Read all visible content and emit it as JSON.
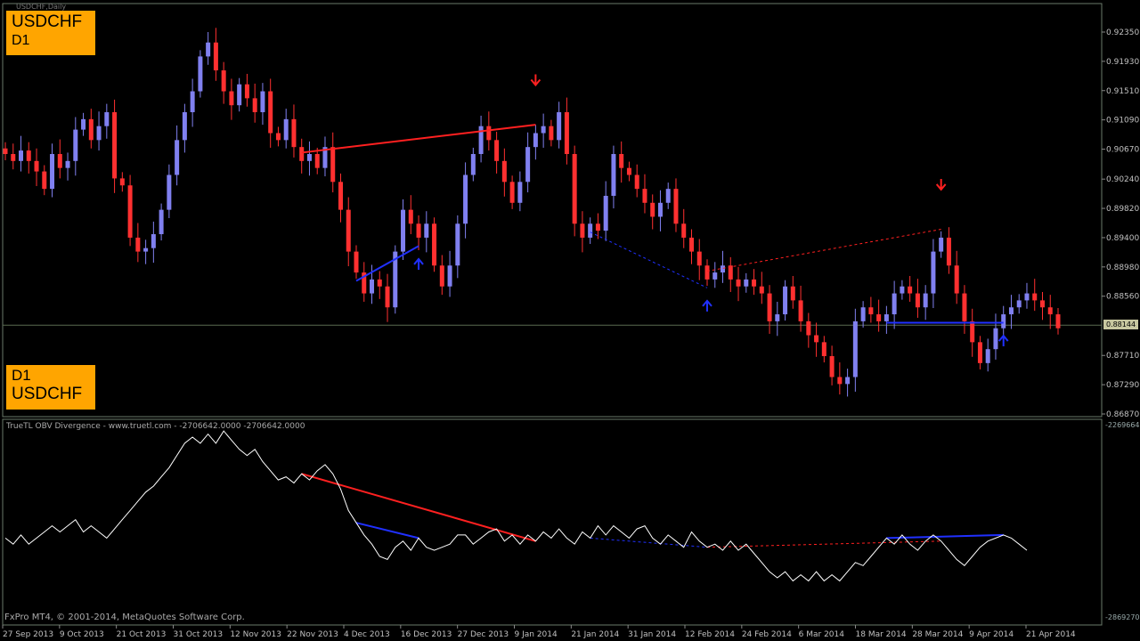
{
  "window": {
    "chart_title": "USDCHF,Daily",
    "badge_top": {
      "symbol": "USDCHF",
      "timeframe": "D1"
    },
    "badge_bottom": {
      "timeframe": "D1",
      "symbol": "USDCHF"
    },
    "indicator_title": "TrueTL OBV Divergence - www.truetl.com -  -2706642.0000 -2706642.0000",
    "copyright": "FxPro MT4, © 2001-2014, MetaQuotes Software Corp.",
    "current_price": "0.88144",
    "indicator_top_value": "-2269664",
    "indicator_bottom_value": "-2869270"
  },
  "colors": {
    "background": "#000000",
    "bull_candle": "#8080f0",
    "bear_candle": "#ff3030",
    "obv_line": "#ffffff",
    "bearish_divergence": "#ff2020",
    "bullish_divergence": "#2030ff",
    "badge": "#ffa500",
    "axis_text": "#c0c0c0"
  },
  "chart_data": [
    {
      "type": "candlestick",
      "title": "",
      "ylim": [
        0.8675,
        0.9255
      ],
      "y_ticks": [
        "0.92350",
        "0.91930",
        "0.91510",
        "0.91090",
        "0.90670",
        "0.90240",
        "0.89820",
        "0.89400",
        "0.88980",
        "0.88560",
        "0.87710",
        "0.87290",
        "0.86870"
      ],
      "x_ticks": [
        "27 Sep 2013",
        "9 Oct 2013",
        "21 Oct 2013",
        "31 Oct 2013",
        "12 Nov 2013",
        "22 Nov 2013",
        "4 Dec 2013",
        "16 Dec 2013",
        "27 Dec 2013",
        "9 Jan 2014",
        "21 Jan 2014",
        "31 Jan 2014",
        "12 Feb 2014",
        "24 Feb 2014",
        "6 Mar 2014",
        "18 Mar 2014",
        "28 Mar 2014",
        "9 Apr 2014",
        "21 Apr 2014"
      ],
      "close_series": [
        0.906,
        0.905,
        0.9065,
        0.905,
        0.9035,
        0.901,
        0.906,
        0.904,
        0.905,
        0.9095,
        0.911,
        0.908,
        0.91,
        0.912,
        0.9025,
        0.9015,
        0.894,
        0.892,
        0.8925,
        0.8945,
        0.898,
        0.903,
        0.908,
        0.912,
        0.915,
        0.92,
        0.922,
        0.918,
        0.915,
        0.913,
        0.916,
        0.914,
        0.912,
        0.915,
        0.909,
        0.908,
        0.911,
        0.907,
        0.905,
        0.906,
        0.904,
        0.907,
        0.902,
        0.898,
        0.892,
        0.889,
        0.886,
        0.888,
        0.887,
        0.884,
        0.892,
        0.898,
        0.896,
        0.894,
        0.896,
        0.89,
        0.887,
        0.89,
        0.896,
        0.903,
        0.906,
        0.91,
        0.908,
        0.905,
        0.902,
        0.899,
        0.902,
        0.907,
        0.909,
        0.91,
        0.908,
        0.912,
        0.906,
        0.896,
        0.894,
        0.896,
        0.895,
        0.9,
        0.906,
        0.904,
        0.903,
        0.901,
        0.899,
        0.897,
        0.899,
        0.901,
        0.896,
        0.894,
        0.892,
        0.89,
        0.888,
        0.889,
        0.89,
        0.888,
        0.887,
        0.888,
        0.887,
        0.886,
        0.882,
        0.883,
        0.887,
        0.885,
        0.882,
        0.88,
        0.879,
        0.877,
        0.874,
        0.873,
        0.874,
        0.882,
        0.884,
        0.883,
        0.882,
        0.883,
        0.886,
        0.887,
        0.886,
        0.884,
        0.886,
        0.892,
        0.894,
        0.89,
        0.886,
        0.882,
        0.879,
        0.876,
        0.878,
        0.881,
        0.883,
        0.884,
        0.885,
        0.886,
        0.885,
        0.884,
        0.883,
        0.881
      ],
      "divergences": [
        {
          "kind": "bearish",
          "from_date": "22 Nov 2013",
          "to_date": "9 Jan 2014"
        },
        {
          "kind": "bullish",
          "from_date": "4 Dec 2013",
          "to_date": "16 Dec 2013"
        },
        {
          "kind": "bullish-hidden",
          "from_date": "21 Jan 2014",
          "to_date": "12 Feb 2014"
        },
        {
          "kind": "bearish-hidden",
          "from_date": "12 Feb 2014",
          "to_date": "28 Mar 2014"
        },
        {
          "kind": "bullish",
          "from_date": "18 Mar 2014",
          "to_date": "9 Apr 2014"
        }
      ]
    },
    {
      "type": "line",
      "title": "TrueTL OBV Divergence",
      "ylim": [
        -2869270,
        -2269664
      ],
      "series": [
        {
          "values": [
            -2620000,
            -2640000,
            -2610000,
            -2640000,
            -2620000,
            -2600000,
            -2580000,
            -2600000,
            -2580000,
            -2560000,
            -2600000,
            -2580000,
            -2600000,
            -2620000,
            -2590000,
            -2560000,
            -2530000,
            -2500000,
            -2470000,
            -2450000,
            -2420000,
            -2390000,
            -2350000,
            -2310000,
            -2290000,
            -2310000,
            -2280000,
            -2310000,
            -2270000,
            -2300000,
            -2330000,
            -2350000,
            -2330000,
            -2370000,
            -2400000,
            -2430000,
            -2420000,
            -2440000,
            -2410000,
            -2430000,
            -2400000,
            -2380000,
            -2410000,
            -2460000,
            -2530000,
            -2570000,
            -2610000,
            -2640000,
            -2680000,
            -2690000,
            -2650000,
            -2630000,
            -2660000,
            -2620000,
            -2650000,
            -2660000,
            -2650000,
            -2640000,
            -2610000,
            -2610000,
            -2640000,
            -2620000,
            -2600000,
            -2590000,
            -2630000,
            -2610000,
            -2640000,
            -2610000,
            -2630000,
            -2600000,
            -2620000,
            -2590000,
            -2620000,
            -2640000,
            -2600000,
            -2620000,
            -2580000,
            -2610000,
            -2580000,
            -2600000,
            -2620000,
            -2590000,
            -2580000,
            -2620000,
            -2640000,
            -2610000,
            -2630000,
            -2650000,
            -2600000,
            -2630000,
            -2650000,
            -2640000,
            -2660000,
            -2630000,
            -2660000,
            -2640000,
            -2670000,
            -2700000,
            -2730000,
            -2750000,
            -2730000,
            -2760000,
            -2740000,
            -2760000,
            -2730000,
            -2760000,
            -2740000,
            -2760000,
            -2730000,
            -2700000,
            -2710000,
            -2680000,
            -2650000,
            -2620000,
            -2640000,
            -2610000,
            -2640000,
            -2660000,
            -2630000,
            -2610000,
            -2630000,
            -2660000,
            -2690000,
            -2710000,
            -2680000,
            -2650000,
            -2630000,
            -2620000,
            -2610000,
            -2620000,
            -2640000,
            -2660000
          ]
        }
      ]
    }
  ]
}
